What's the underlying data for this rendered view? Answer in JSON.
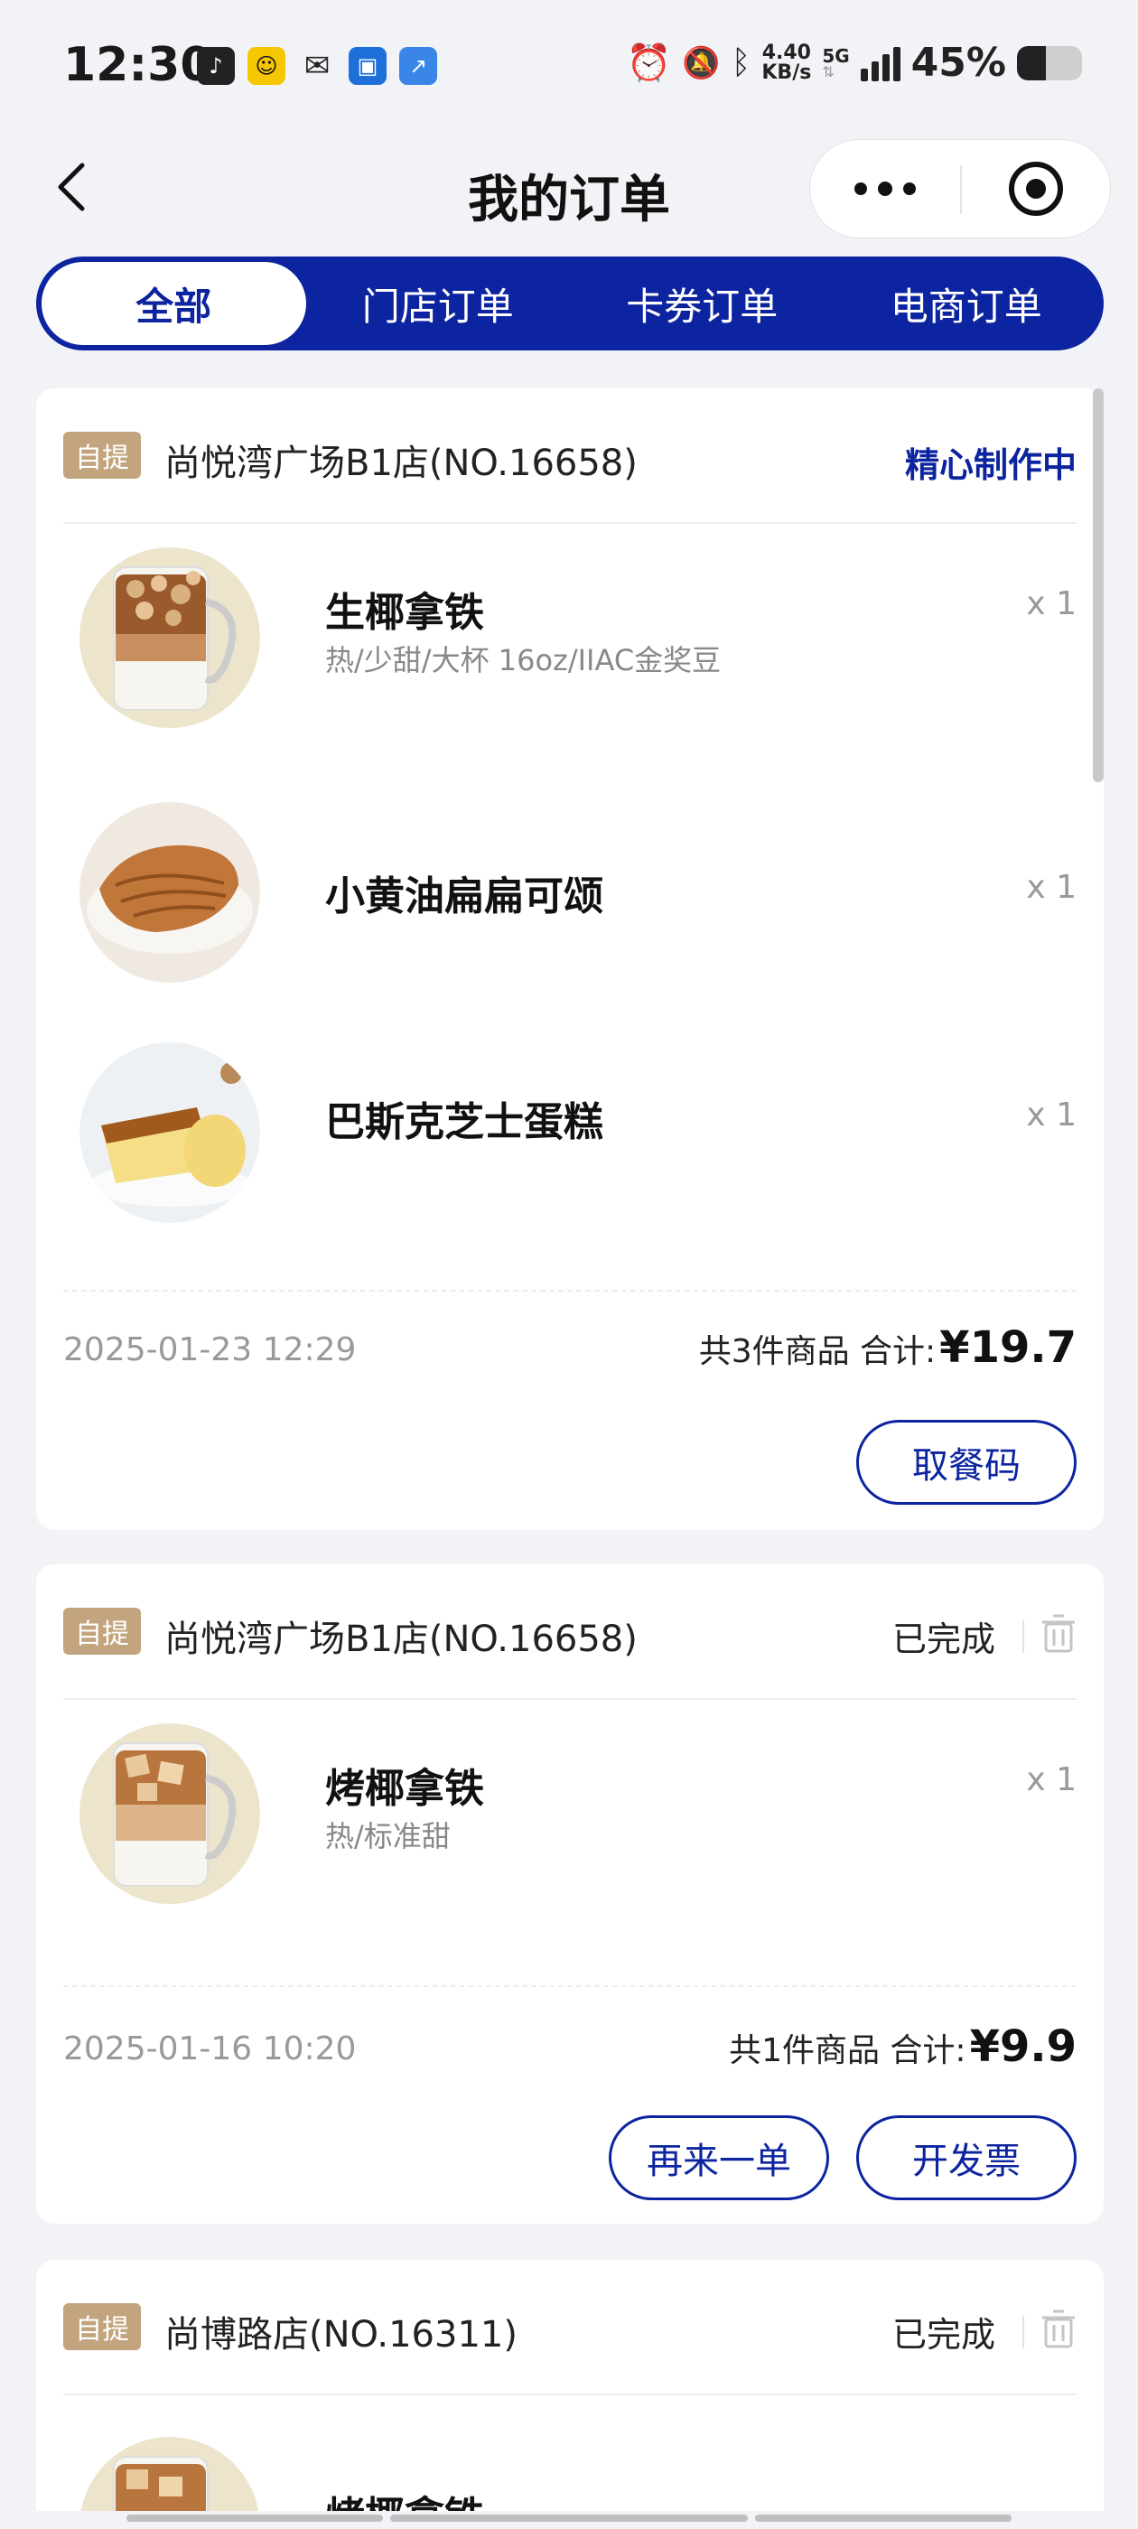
{
  "status_bar": {
    "time": "12:30",
    "network_speed_value": "4.40",
    "network_speed_unit": "KB/s",
    "network_type": "5G",
    "battery_text": "45%",
    "battery_level": 0.45
  },
  "header": {
    "title": "我的订单"
  },
  "tabs": [
    {
      "label": "全部",
      "active": true
    },
    {
      "label": "门店订单",
      "active": false
    },
    {
      "label": "卡券订单",
      "active": false
    },
    {
      "label": "电商订单",
      "active": false
    }
  ],
  "orders": [
    {
      "badge": "自提",
      "store": "尚悦湾广场B1店(NO.16658)",
      "status": "精心制作中",
      "items": [
        {
          "name": "生椰拿铁",
          "spec": "热/少甜/大杯 16oz/IIAC金奖豆",
          "qty": "x 1"
        },
        {
          "name": "小黄油扁扁可颂",
          "spec": "",
          "qty": "x 1"
        },
        {
          "name": "巴斯克芝士蛋糕",
          "spec": "",
          "qty": "x 1"
        }
      ],
      "time": "2025-01-23 12:29",
      "summary_label": "共3件商品 合计:",
      "total": "¥19.7",
      "actions": [
        "取餐码"
      ]
    },
    {
      "badge": "自提",
      "store": "尚悦湾广场B1店(NO.16658)",
      "status": "已完成",
      "items": [
        {
          "name": "烤椰拿铁",
          "spec": "热/标准甜",
          "qty": "x 1"
        }
      ],
      "time": "2025-01-16 10:20",
      "summary_label": "共1件商品 合计:",
      "total": "¥9.9",
      "actions": [
        "再来一单",
        "开发票"
      ]
    },
    {
      "badge": "自提",
      "store": "尚博路店(NO.16311)",
      "status": "已完成",
      "items": [
        {
          "name": "烤椰拿铁",
          "spec": "",
          "qty": ""
        }
      ]
    }
  ],
  "colors": {
    "brand_blue": "#0d24a0",
    "badge_tan": "#c2a47e",
    "page_bg": "#f2f3f6"
  },
  "icons": {
    "back": "chevron-left-icon",
    "more": "more-dots-icon",
    "close_target": "target-circle-icon",
    "trash": "trash-icon"
  }
}
